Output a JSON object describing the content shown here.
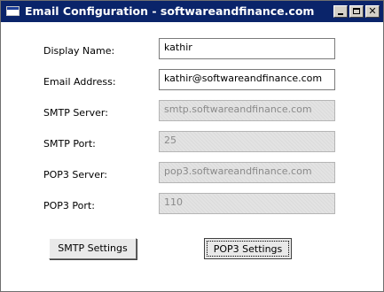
{
  "window": {
    "title": "Email Configuration - softwareandfinance.com",
    "controls": {
      "minimize": "minimize",
      "maximize": "maximize",
      "close": "close"
    }
  },
  "form": {
    "display_name": {
      "label": "Display Name:",
      "value": "kathir",
      "enabled": true
    },
    "email_address": {
      "label": "Email Address:",
      "value": "kathir@softwareandfinance.com",
      "enabled": true
    },
    "smtp_server": {
      "label": "SMTP Server:",
      "value": "smtp.softwareandfinance.com",
      "enabled": false
    },
    "smtp_port": {
      "label": "SMTP Port:",
      "value": "25",
      "enabled": false
    },
    "pop3_server": {
      "label": "POP3 Server:",
      "value": "pop3.softwareandfinance.com",
      "enabled": false
    },
    "pop3_port": {
      "label": "POP3 Port:",
      "value": "110",
      "enabled": false
    }
  },
  "buttons": {
    "smtp_settings": "SMTP Settings",
    "pop3_settings": "POP3 Settings"
  },
  "colors": {
    "titlebar": "#0a246a",
    "disabled_field": "#e3e3e3"
  }
}
